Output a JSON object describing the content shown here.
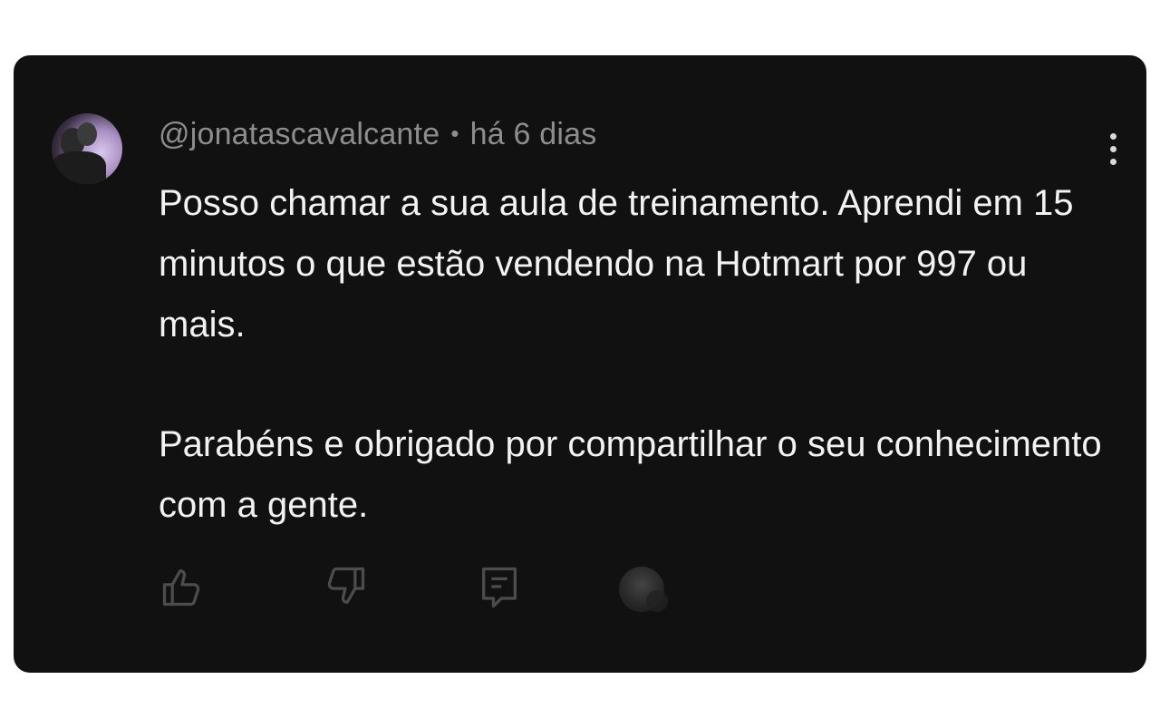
{
  "comment": {
    "username": "@jonatascavalcante",
    "separator": "•",
    "timestamp": "há 6 dias",
    "paragraphs": [
      "Posso chamar a sua aula de treinamento. Aprendi em 15 minutos o que estão vendendo na Hotmart por 997 ou mais.",
      "Parabéns e obrigado por compartilhar o seu conhecimento com a gente."
    ]
  },
  "icons": {
    "more": "more-vertical-icon",
    "like": "thumbs-up-icon",
    "dislike": "thumbs-down-icon",
    "reply": "comment-icon",
    "creator": "creator-avatar"
  },
  "colors": {
    "card_bg": "#111111",
    "text": "#f2f2f2",
    "meta": "#8d8d8d"
  }
}
